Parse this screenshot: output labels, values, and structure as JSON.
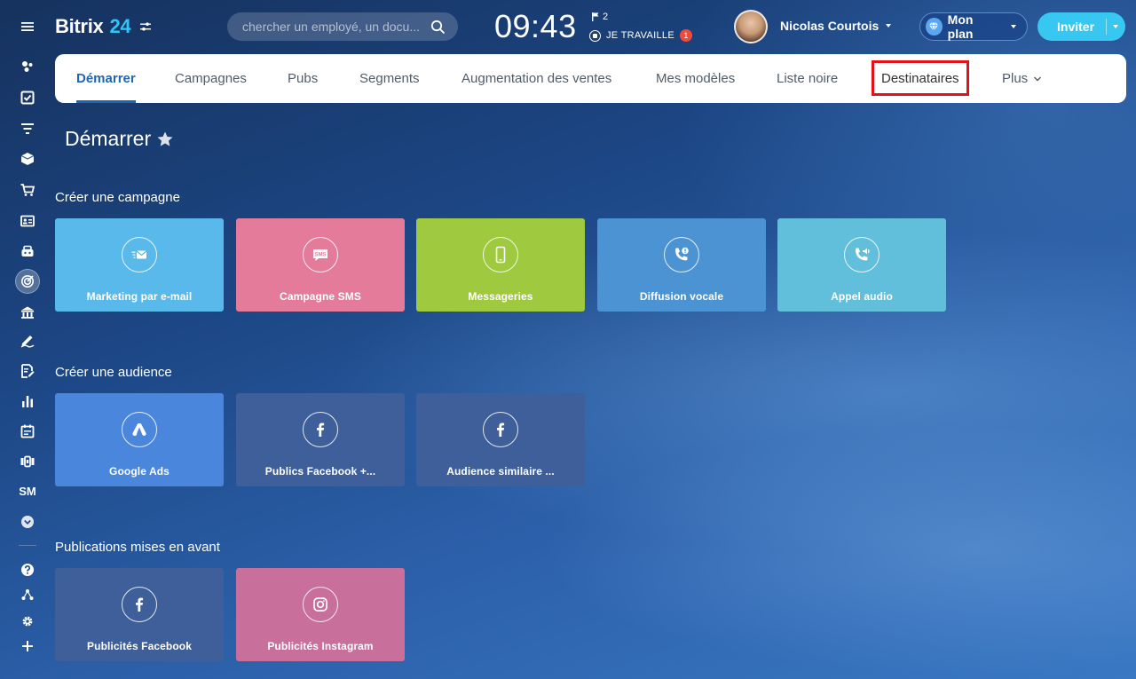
{
  "header": {
    "logo_name": "Bitrix",
    "logo_num": "24",
    "search_placeholder": "chercher un employé, un docu...",
    "clock": "09:43",
    "flag_count": "2",
    "work_status": "JE TRAVAILLE",
    "work_badge": "1",
    "user_name": "Nicolas Courtois",
    "plan_label": "Mon plan",
    "invite_label": "Inviter"
  },
  "sidebar": {
    "sm_label": "SM",
    "icons": [
      "menu-icon",
      "activity-icon",
      "tasks-icon",
      "filter-icon",
      "box-icon",
      "cart-icon",
      "contact-card-icon",
      "robot-icon",
      "target-icon",
      "bank-icon",
      "sign-icon",
      "document-edit-icon",
      "chart-icon",
      "calendar-list-icon",
      "video-icon",
      "sm-label",
      "chevron-down-circle-icon",
      "help-icon",
      "network-icon",
      "gear-icon",
      "plus-icon"
    ]
  },
  "tabs": [
    {
      "label": "Démarrer"
    },
    {
      "label": "Campagnes"
    },
    {
      "label": "Pubs"
    },
    {
      "label": "Segments"
    },
    {
      "label": "Augmentation des ventes"
    },
    {
      "label": "Mes modèles"
    },
    {
      "label": "Liste noire"
    },
    {
      "label": "Destinataires"
    },
    {
      "label": "Plus"
    }
  ],
  "page_title": "Démarrer",
  "sections": {
    "campaign": {
      "title": "Créer une campagne",
      "cards": [
        {
          "label": "Marketing par e-mail",
          "color": "#59b9ea",
          "icon": "email-icon"
        },
        {
          "label": "Campagne SMS",
          "color": "#e57b9b",
          "icon": "sms-icon"
        },
        {
          "label": "Messageries",
          "color": "#9fc93e",
          "icon": "phone-device-icon"
        },
        {
          "label": "Diffusion vocale",
          "color": "#4b93d2",
          "icon": "voice-broadcast-icon"
        },
        {
          "label": "Appel audio",
          "color": "#61bfdc",
          "icon": "audio-call-icon"
        }
      ]
    },
    "audience": {
      "title": "Créer une audience",
      "cards": [
        {
          "label": "Google Ads",
          "color": "#4a86db",
          "icon": "google-ads-icon"
        },
        {
          "label": "Publics Facebook +...",
          "color": "#3e5f9a",
          "icon": "facebook-icon"
        },
        {
          "label": "Audience similaire ...",
          "color": "#3e5f9a",
          "icon": "facebook-icon"
        }
      ]
    },
    "promoted": {
      "title": "Publications mises en avant",
      "cards": [
        {
          "label": "Publicités Facebook",
          "color": "#3e5f9a",
          "icon": "facebook-icon"
        },
        {
          "label": "Publicités Instagram",
          "color": "#c96f9b",
          "icon": "instagram-icon"
        }
      ]
    }
  }
}
